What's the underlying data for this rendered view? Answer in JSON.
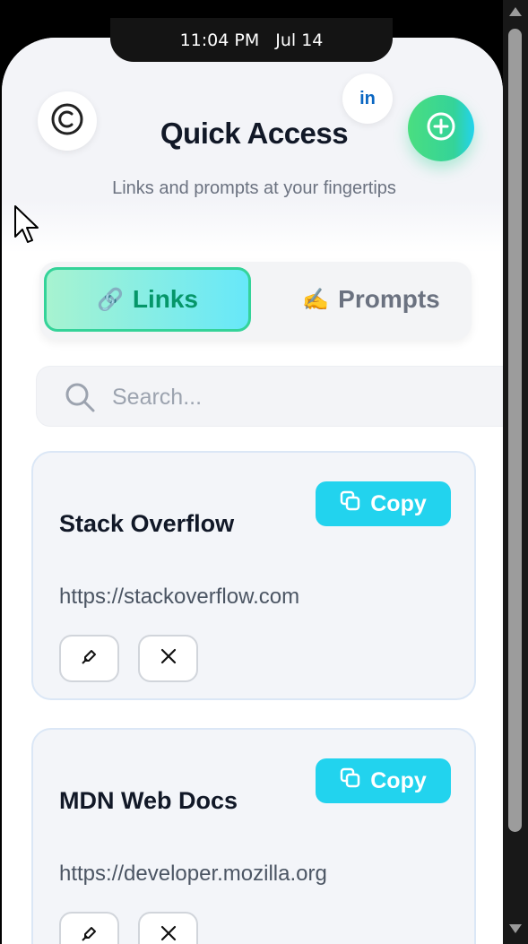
{
  "status_bar": {
    "time": "11:04 PM",
    "date": "Jul 14"
  },
  "header": {
    "title": "Quick Access",
    "subtitle": "Links and prompts at your fingertips",
    "linkedin_label": "in"
  },
  "tabs": [
    {
      "icon": "🔗",
      "label": "Links",
      "active": true
    },
    {
      "icon": "✍️",
      "label": "Prompts",
      "active": false
    }
  ],
  "search": {
    "placeholder": "Search...",
    "value": ""
  },
  "cards": [
    {
      "title": "Stack Overflow",
      "url": "https://stackoverflow.com",
      "copy_label": "Copy"
    },
    {
      "title": "MDN Web Docs",
      "url": "https://developer.mozilla.org",
      "copy_label": "Copy"
    }
  ],
  "colors": {
    "accent_green": "#34d399",
    "accent_cyan": "#22d3ee",
    "title_text": "#111827",
    "linkedin_blue": "#0a66c2"
  },
  "icons": {
    "theme": "theme-toggle-icon",
    "linkedin": "linkedin-icon",
    "add": "plus-circle-icon",
    "search": "search-icon",
    "copy": "copy-icon",
    "edit": "edit-icon",
    "delete": "close-icon"
  }
}
